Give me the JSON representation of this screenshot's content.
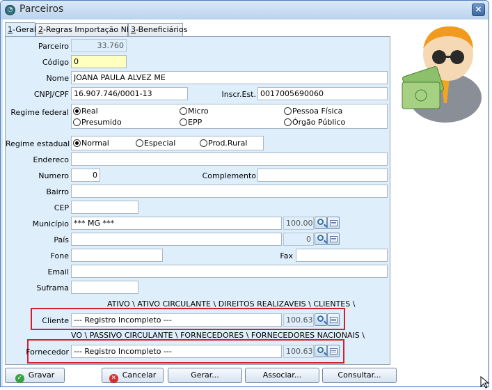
{
  "window": {
    "title": "Parceiros",
    "close_glyph": "×"
  },
  "tabs": [
    {
      "key": "1",
      "label": "-Geral",
      "active": true
    },
    {
      "key": "2",
      "label": "-Regras Importação NFe",
      "active": false
    },
    {
      "key": "3",
      "label": "-Beneficiários",
      "active": false
    }
  ],
  "form": {
    "parceiro_label": "Parceiro",
    "parceiro_value": "33.760",
    "codigo_label": "Código",
    "codigo_value": "0",
    "nome_label": "Nome",
    "nome_value": "JOANA PAULA ALVEZ ME",
    "cnpj_label": "CNPJ/CPF",
    "cnpj_value": "16.907.746/0001-13",
    "ie_label": "Inscr.Est.",
    "ie_value": "0017005690060",
    "regime_federal_label": "Regime federal",
    "regime_federal_options": [
      "Real",
      "Micro",
      "Pessoa Física",
      "Presumido",
      "EPP",
      "Órgão Público"
    ],
    "regime_federal_selected": "Real",
    "regime_estadual_label": "Regime estadual",
    "regime_estadual_options": [
      "Normal",
      "Especial",
      "Prod.Rural"
    ],
    "regime_estadual_selected": "Normal",
    "endereco_label": "Endereco",
    "endereco_value": "",
    "numero_label": "Numero",
    "numero_value": "0",
    "complemento_label": "Complemento",
    "complemento_value": "",
    "bairro_label": "Bairro",
    "bairro_value": "",
    "cep_label": "CEP",
    "cep_value": "",
    "municipio_label": "Município",
    "municipio_value": "*** MG ***",
    "municipio_code": "100.000",
    "pais_label": "País",
    "pais_value": "",
    "pais_code": "0",
    "fone_label": "Fone",
    "fone_value": "",
    "fax_label": "Fax",
    "fax_value": "",
    "email_label": "Email",
    "email_value": "",
    "suframa_label": "Suframa",
    "suframa_value": "",
    "cliente_path": "ATIVO \\ ATIVO CIRCULANTE \\ DIREITOS REALIZAVEIS \\ CLIENTES \\",
    "cliente_label": "Cliente",
    "cliente_value": "--- Registro Incompleto ---",
    "cliente_code": "100.630",
    "fornecedor_path": "VO \\ PASSIVO CIRCULANTE \\ FORNECEDORES \\ FORNECEDORES NACIONAIS \\",
    "fornecedor_label": "Fornecedor",
    "fornecedor_value": "--- Registro Incompleto ---",
    "fornecedor_code": "100.631"
  },
  "buttons": {
    "gravar": "Gravar",
    "cancelar": "Cancelar",
    "gerar": "Gerar...",
    "associar": "Associar...",
    "consultar": "Consultar..."
  },
  "colors": {
    "accent": "#4e7fb8",
    "panel": "#dfeefb",
    "highlight_box": "#d2202f",
    "required_field": "#ffffc0"
  }
}
